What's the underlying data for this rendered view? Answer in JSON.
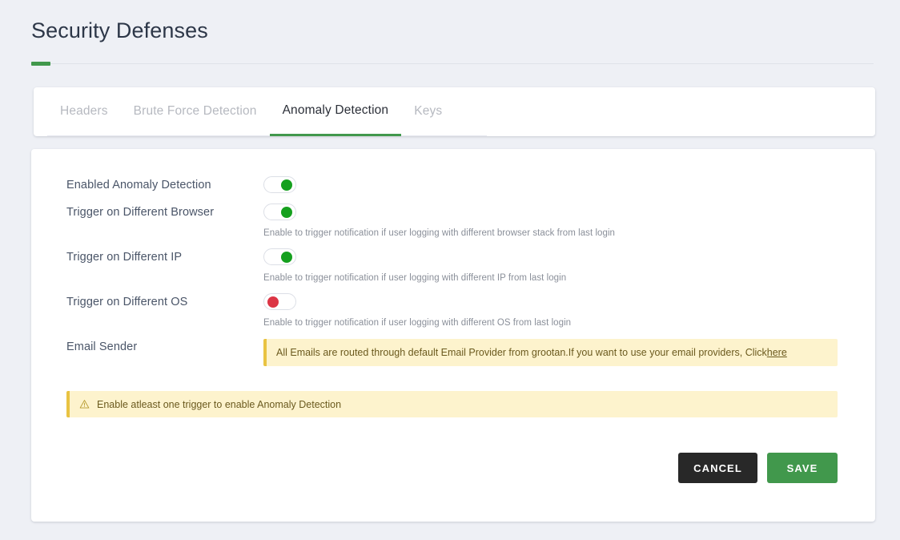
{
  "header": {
    "title": "Security Defenses"
  },
  "tabs": [
    {
      "label": "Headers",
      "active": false
    },
    {
      "label": "Brute Force Detection",
      "active": false
    },
    {
      "label": "Anomaly Detection",
      "active": true
    },
    {
      "label": "Keys",
      "active": false
    }
  ],
  "form": {
    "rows": [
      {
        "label": "Enabled Anomaly Detection",
        "toggle": "on",
        "helper": ""
      },
      {
        "label": "Trigger on Different Browser",
        "toggle": "on",
        "helper": "Enable to trigger notification if user logging with different browser stack from last login"
      },
      {
        "label": "Trigger on Different IP",
        "toggle": "on",
        "helper": "Enable to trigger notification if user logging with different IP from last login"
      },
      {
        "label": "Trigger on Different OS",
        "toggle": "off",
        "helper": "Enable to trigger notification if user logging with different OS from last login"
      }
    ],
    "email_sender": {
      "label": "Email Sender",
      "banner_text": "All Emails are routed through default Email Provider from grootan.If you want to use your email providers, Click ",
      "banner_link": "here"
    }
  },
  "warning": {
    "icon": "warning-triangle-icon",
    "text": "Enable atleast one trigger to enable Anomaly Detection"
  },
  "actions": {
    "cancel_label": "CANCEL",
    "save_label": "SAVE"
  },
  "colors": {
    "accent_green": "#41984c",
    "toggle_on": "#15a01e",
    "toggle_off": "#dc3545",
    "banner_bg": "#fdf3cd",
    "banner_border": "#e9c342",
    "cancel_bg": "#282828",
    "page_bg": "#eef0f5"
  }
}
